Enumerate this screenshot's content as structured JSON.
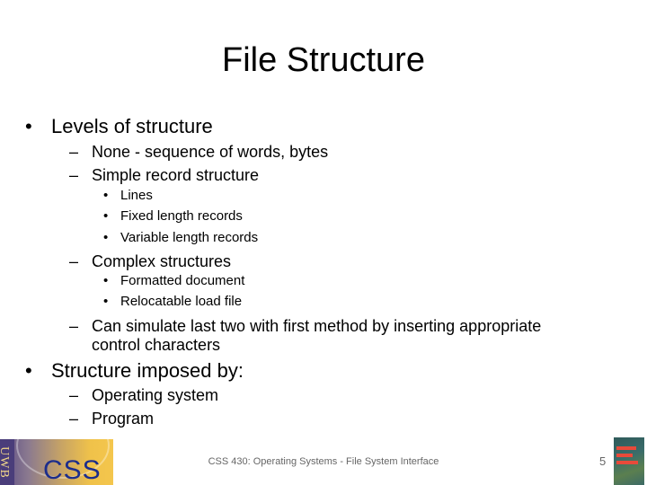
{
  "slide": {
    "title": "File Structure",
    "bullets": [
      {
        "level": 1,
        "text": "Levels of structure"
      },
      {
        "level": 2,
        "text": "None - sequence of words, bytes"
      },
      {
        "level": 2,
        "text": "Simple record structure"
      },
      {
        "level": 3,
        "text": "Lines"
      },
      {
        "level": 3,
        "text": "Fixed length records"
      },
      {
        "level": 3,
        "text": "Variable length records"
      },
      {
        "level": 2,
        "text": "Complex structures"
      },
      {
        "level": 3,
        "text": "Formatted document"
      },
      {
        "level": 3,
        "text": "Relocatable load file"
      },
      {
        "level": 2,
        "text": "Can simulate last two with first method by inserting appropriate"
      },
      {
        "level": 2,
        "text": "control characters",
        "continuation": true
      },
      {
        "level": 1,
        "text": "Structure imposed by:"
      },
      {
        "level": 2,
        "text": "Operating system"
      },
      {
        "level": 2,
        "text": "Program"
      }
    ],
    "bullet_glyphs": {
      "level1": "•",
      "level2": "–",
      "level3": "•"
    }
  },
  "footer": {
    "text": "CSS 430: Operating Systems - File System Interface",
    "page_number": "5",
    "logo_left": {
      "uwb": "UWB",
      "css": "CSS"
    }
  }
}
